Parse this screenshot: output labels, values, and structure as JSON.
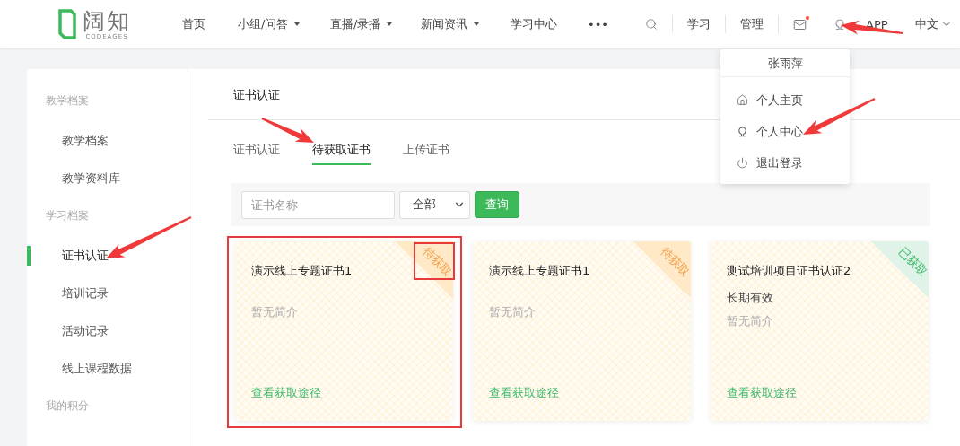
{
  "header": {
    "logo": {
      "name": "阔知",
      "sub": "CODEAGES"
    },
    "nav": [
      {
        "label": "首页",
        "dropdown": false
      },
      {
        "label": "小组/问答",
        "dropdown": true
      },
      {
        "label": "直播/录播",
        "dropdown": true
      },
      {
        "label": "新闻资讯",
        "dropdown": true
      },
      {
        "label": "学习中心",
        "dropdown": false
      },
      {
        "label": "•••",
        "dropdown": false
      }
    ],
    "links": [
      "学习",
      "管理"
    ],
    "mail": {
      "unread": true
    },
    "user": {
      "pointed": true
    },
    "app": "APP",
    "language": {
      "label": "中文",
      "dropdown": true
    }
  },
  "user_menu": {
    "name": "张雨萍",
    "items": [
      {
        "label": "个人主页",
        "pointed": false
      },
      {
        "label": "个人中心",
        "pointed": true
      },
      {
        "label": "退出登录",
        "pointed": false
      }
    ]
  },
  "sidebar": [
    {
      "title": "教学档案",
      "items": [
        {
          "label": "教学档案",
          "selected": false,
          "pointed": false
        },
        {
          "label": "教学资料库",
          "selected": false,
          "pointed": false
        }
      ]
    },
    {
      "title": "学习档案",
      "items": [
        {
          "label": "证书认证",
          "selected": true,
          "pointed": true
        },
        {
          "label": "培训记录",
          "selected": false,
          "pointed": false
        },
        {
          "label": "活动记录",
          "selected": false,
          "pointed": false
        },
        {
          "label": "线上课程数据",
          "selected": false,
          "pointed": false
        }
      ]
    },
    {
      "title": "我的积分"
    }
  ],
  "page_title": "证书认证",
  "tabs": [
    {
      "label": "证书认证",
      "selected": false,
      "pointed": false
    },
    {
      "label": "待获取证书",
      "selected": true,
      "pointed": true
    },
    {
      "label": "上传证书",
      "selected": false,
      "pointed": false
    }
  ],
  "filter": {
    "placeholder": "证书名称",
    "select": "全部",
    "button": "查询"
  },
  "cards": [
    {
      "title": "演示线上专题证书1",
      "intro": "暂无简介",
      "link": "查看获取途径",
      "status": {
        "label": "待获取",
        "kind": "pending",
        "highlighted": true
      },
      "highlighted": true
    },
    {
      "title": "演示线上专题证书1",
      "intro": "暂无简介",
      "link": "查看获取途径",
      "status": {
        "label": "待获取",
        "kind": "pending",
        "highlighted": false
      },
      "highlighted": false
    },
    {
      "title": "测试培训项目证书认证2",
      "validity": "长期有效",
      "intro": "暂无简介",
      "link": "查看获取途径",
      "status": {
        "label": "已获取",
        "kind": "obtained",
        "highlighted": false
      },
      "highlighted": false
    }
  ]
}
